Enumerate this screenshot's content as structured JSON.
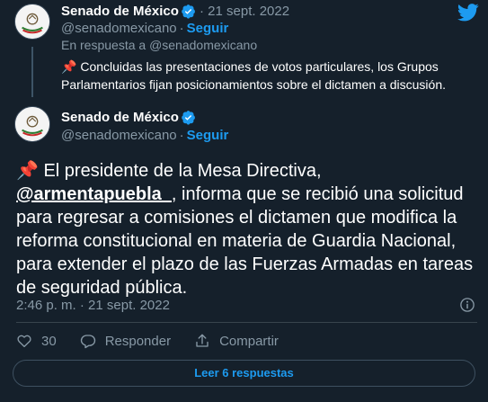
{
  "reply_tweet": {
    "author_name": "Senado de México",
    "author_handle": "@senadomexicano",
    "date": "21 sept. 2022",
    "follow_label": "Seguir",
    "reply_prefix": "En respuesta a",
    "reply_handle": "@senadomexicano",
    "text": "Concluidas las presentaciones de votos particulares, los Grupos Parlamentarios fijan posicionamientos sobre el dictamen a discusión."
  },
  "main_tweet": {
    "author_name": "Senado de México",
    "author_handle": "@senadomexicano",
    "follow_label": "Seguir",
    "text_before_mention": "El presidente de la Mesa Directiva,",
    "mention": "@armentapuebla_",
    "text_after_mention": ", informa que se recibió una solicitud para regresar a comisiones el dictamen que modifica la reforma constitucional en materia de Guardia Nacional, para extender el plazo de las Fuerzas Armadas en tareas de seguridad pública.",
    "timestamp": "2:46 p. m. · 21 sept. 2022"
  },
  "actions": {
    "like_count": "30",
    "reply_label": "Responder",
    "share_label": "Compartir"
  },
  "read_replies_label": "Leer 6 respuestas",
  "icons": {
    "pin": "📌",
    "dot": "·"
  },
  "colors": {
    "background": "#15202b",
    "accent": "#1d9bf0",
    "muted": "#8899a6",
    "divider": "#38444d"
  }
}
